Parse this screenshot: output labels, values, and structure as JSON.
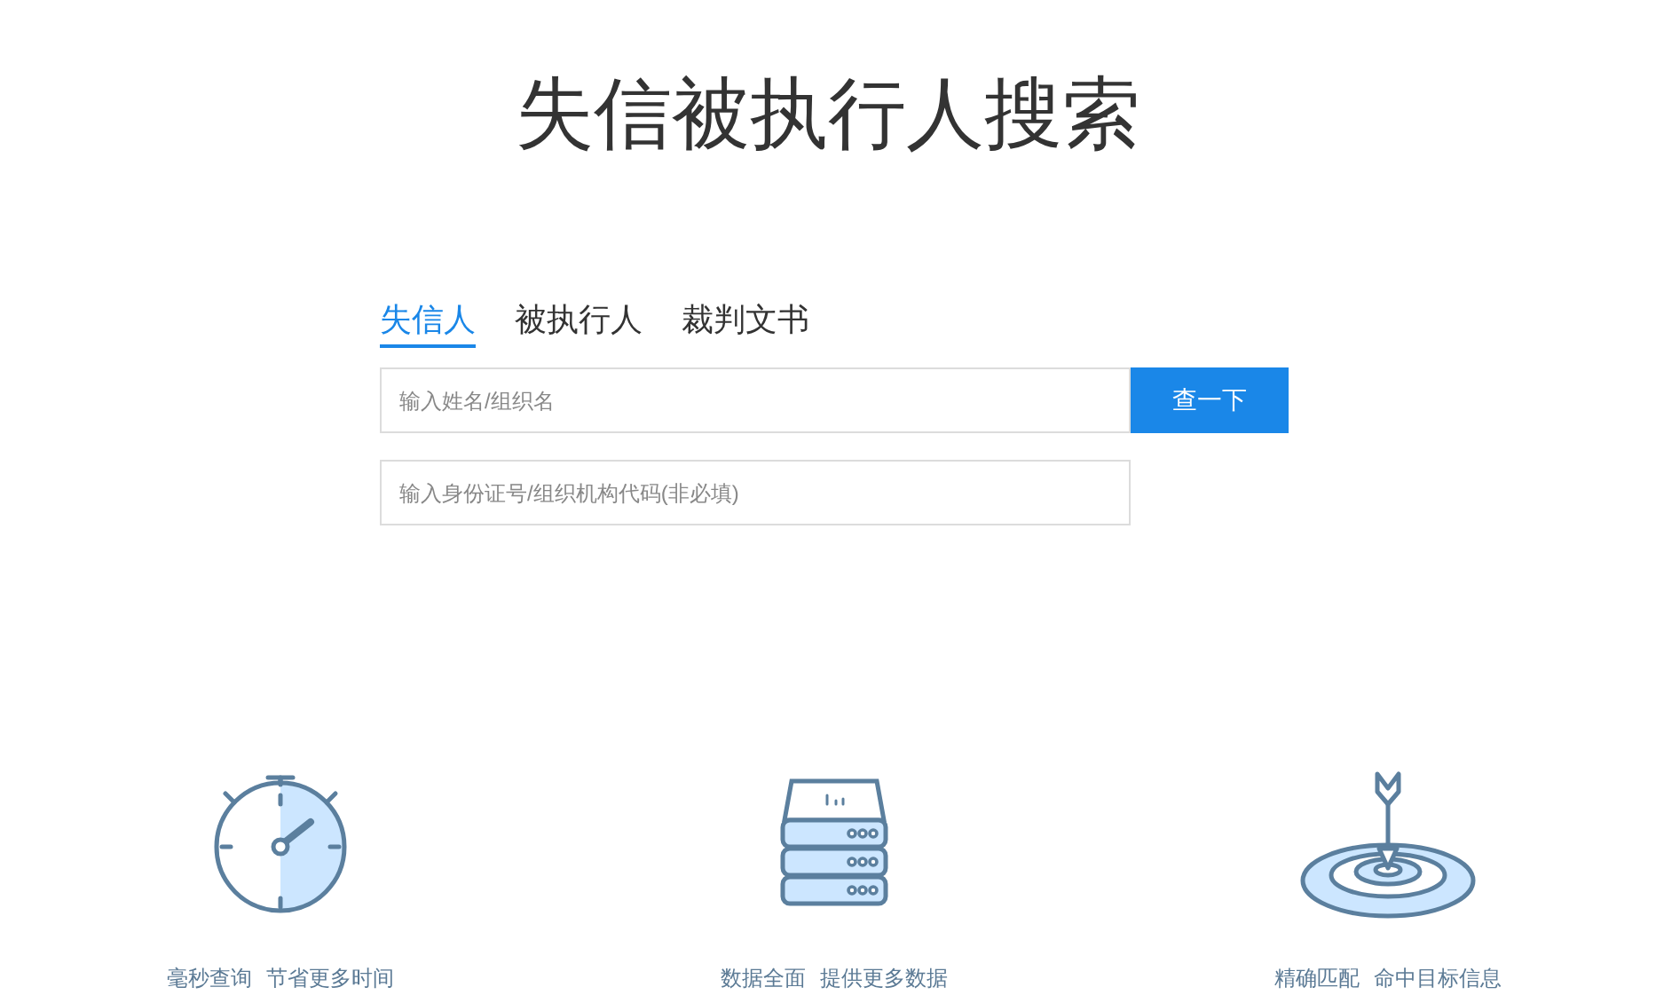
{
  "title": "失信被执行人搜索",
  "tabs": [
    {
      "label": "失信人",
      "selected": true
    },
    {
      "label": "被执行人",
      "selected": false
    },
    {
      "label": "裁判文书",
      "selected": false
    }
  ],
  "name_field": {
    "placeholder": "输入姓名/组织名"
  },
  "search_button": "查一下",
  "id_field": {
    "placeholder": "输入身份证号/组织机构代码(非必填)"
  },
  "features": [
    {
      "kind": "stopwatch",
      "title": "毫秒查询",
      "subtitle": "节省更多时间"
    },
    {
      "kind": "server",
      "title": "数据全面",
      "subtitle": "提供更多数据"
    },
    {
      "kind": "target",
      "title": "精确匹配",
      "subtitle": "命中目标信息"
    }
  ]
}
